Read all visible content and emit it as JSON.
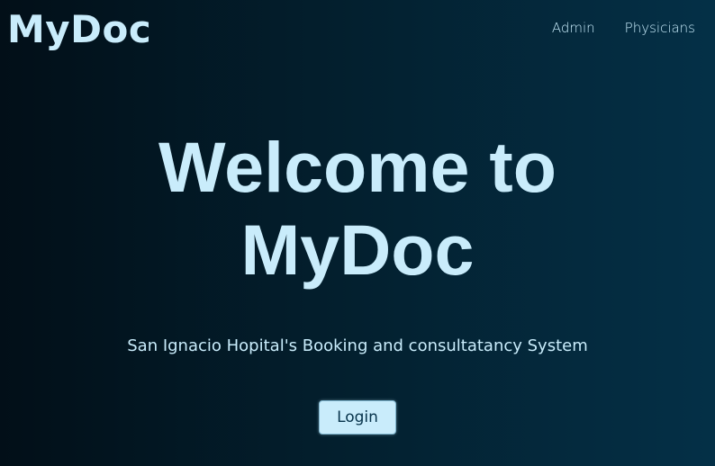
{
  "header": {
    "logo_text": "MyDoc",
    "nav": [
      {
        "label": "Admin"
      },
      {
        "label": "Physicians"
      }
    ]
  },
  "hero": {
    "title_line1": "Welcome to",
    "title_line2": "MyDoc",
    "subtitle": "San Ignacio Hopital's Booking and consultatancy System",
    "login_label": "Login"
  },
  "colors": {
    "text": "#c9ecfb",
    "background_left": "#020f18",
    "background_right": "#043047",
    "button_text": "#06324a"
  }
}
